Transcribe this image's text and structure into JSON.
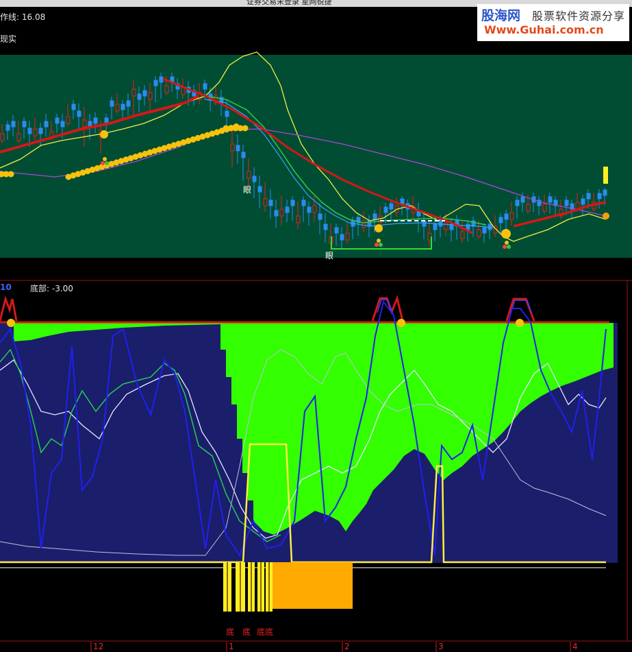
{
  "window": {
    "title": "证券交易未登录  星网锐捷"
  },
  "watermark": {
    "brand": "股海网",
    "slogan": "股票软件资源分享",
    "url": "Www.Guhai.com.cn"
  },
  "upper_panel": {
    "support_line_text": "作线: 16.08",
    "strategy_text": "现实",
    "eye_marker": "眼"
  },
  "lower_panel": {
    "param_value": "10",
    "bottom_label": "底部: -3.00",
    "bottom_signal_text": "底",
    "bottom_cluster_text": "底底"
  },
  "x_axis": {
    "ticks": [
      "12",
      "1",
      "2",
      "3",
      "4"
    ]
  },
  "colors": {
    "upper_bg": "#004d33",
    "lower_bg": "#1b1e6b",
    "green_fill": "#33ff00",
    "up_candle": "#e81e1e",
    "down_candle": "#2a8cf0",
    "trend_red": "#d41818",
    "yellow": "#ffee44",
    "orange": "#ffaa00",
    "purple": "#b044dd"
  },
  "chart_data": [
    {
      "type": "candlestick",
      "title": "",
      "description_free": true,
      "annotations": [
        "眼",
        "眼"
      ],
      "series": [
        {
          "name": "",
          "values": []
        }
      ]
    },
    {
      "type": "line",
      "title": "",
      "x_ticks": [
        "12",
        "1",
        "2",
        "3",
        "4"
      ],
      "series": []
    }
  ]
}
